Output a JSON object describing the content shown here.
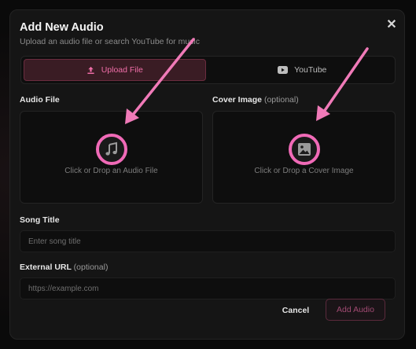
{
  "modal": {
    "title": "Add New Audio",
    "subtitle": "Upload an audio file or search YouTube for music",
    "close_glyph": "✕"
  },
  "tabs": [
    {
      "label": "Upload File",
      "icon": "upload-icon",
      "active": true
    },
    {
      "label": "YouTube",
      "icon": "youtube-icon",
      "active": false
    }
  ],
  "audio_file": {
    "label": "Audio File",
    "drop_text": "Click or Drop an Audio File",
    "icon": "music-note-icon"
  },
  "cover_image": {
    "label": "Cover Image",
    "optional_label": "(optional)",
    "drop_text": "Click or Drop a Cover Image",
    "icon": "image-icon"
  },
  "song_title": {
    "label": "Song Title",
    "placeholder": "Enter song title",
    "value": ""
  },
  "external_url": {
    "label": "External URL",
    "optional_label": "(optional)",
    "placeholder": "https://example.com",
    "value": ""
  },
  "actions": {
    "cancel_label": "Cancel",
    "add_label": "Add Audio"
  },
  "colors": {
    "accent": "#f06ea8",
    "annotation": "#f07ab8",
    "background": "#151515"
  }
}
